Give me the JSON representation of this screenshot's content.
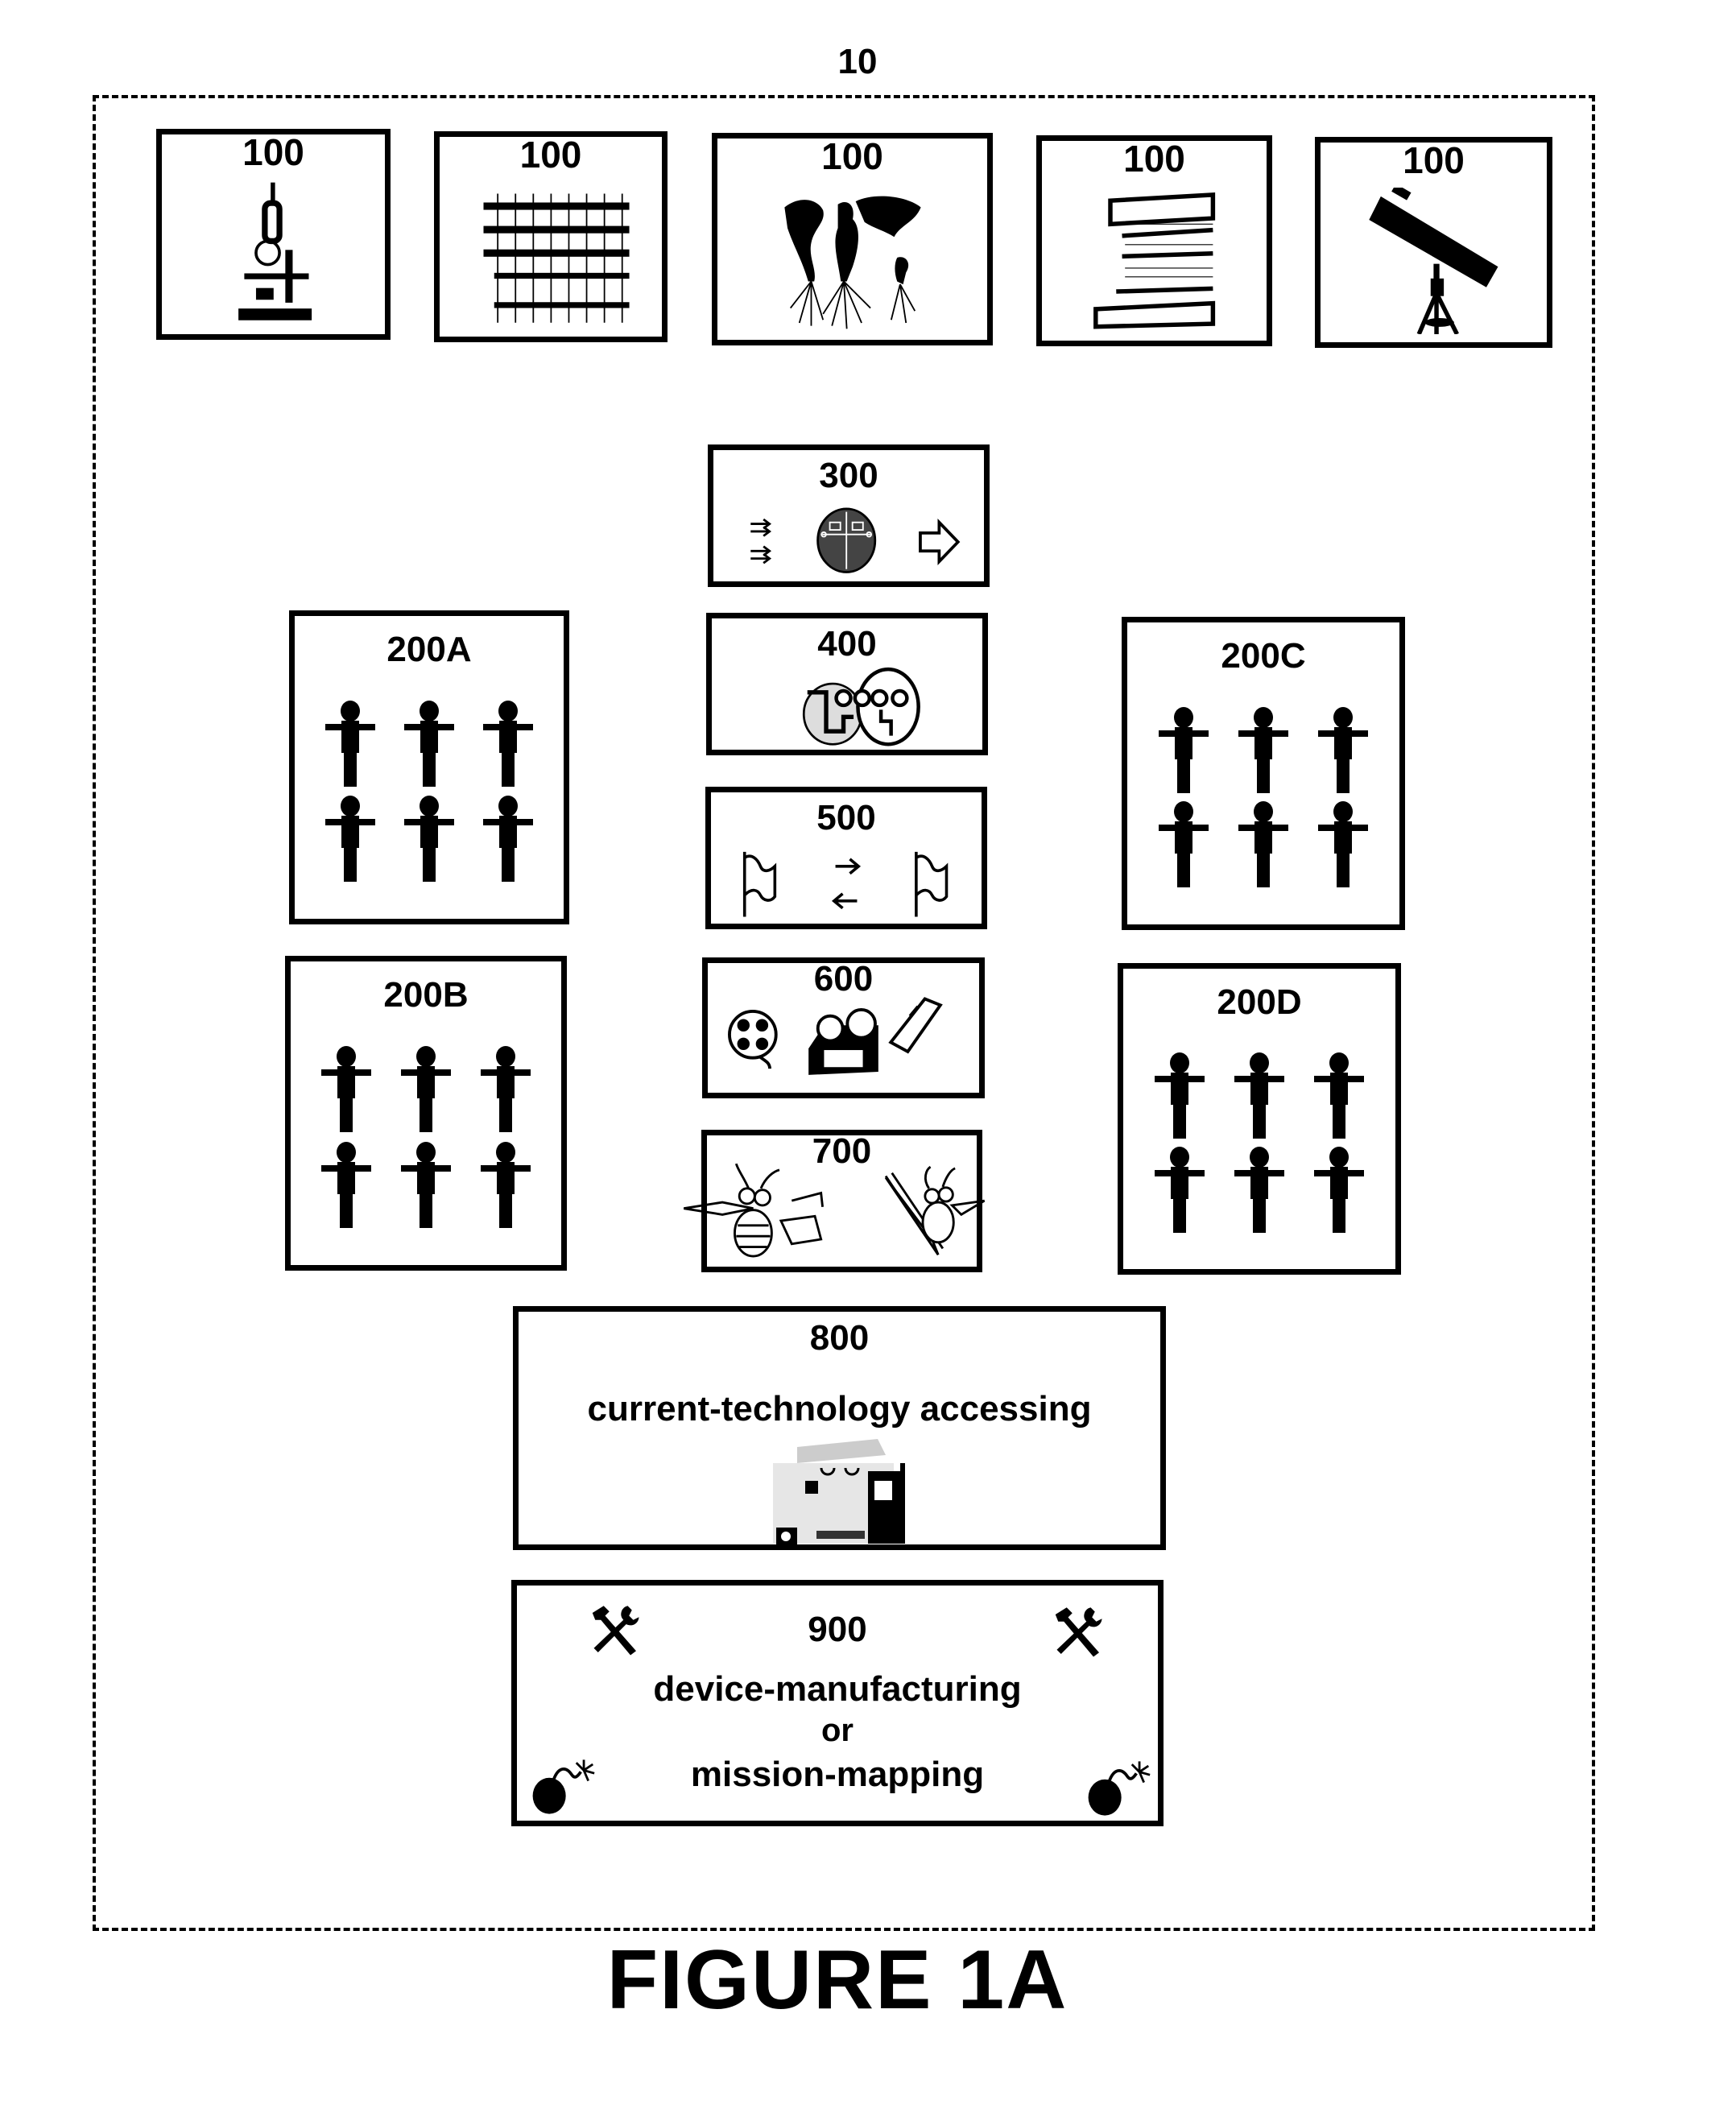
{
  "figure": {
    "system_ref": "10",
    "caption": "FIGURE 1A"
  },
  "top_row": [
    {
      "ref": "100",
      "icon": "microscope-icon"
    },
    {
      "ref": "100",
      "icon": "text-document-icon"
    },
    {
      "ref": "100",
      "icon": "world-map-roots-icon"
    },
    {
      "ref": "100",
      "icon": "books-stack-icon"
    },
    {
      "ref": "100",
      "icon": "telescope-icon"
    }
  ],
  "center_column": [
    {
      "ref": "300",
      "icons": [
        "double-arrows-icon",
        "circuit-globe-icon",
        "right-arrow-icon"
      ]
    },
    {
      "ref": "400",
      "icons": [
        "faces-with-glasses-icon"
      ]
    },
    {
      "ref": "500",
      "icons": [
        "flag-icon",
        "exchange-arrows-icon",
        "flag-icon"
      ]
    },
    {
      "ref": "600",
      "icons": [
        "film-reel-icon",
        "projector-icon",
        "handheld-device-icon"
      ]
    },
    {
      "ref": "700",
      "icons": [
        "bee-with-paper-icon",
        "bee-with-pencil-icon"
      ]
    }
  ],
  "groups": [
    {
      "ref": "200A",
      "people_count": 6
    },
    {
      "ref": "200B",
      "people_count": 6
    },
    {
      "ref": "200C",
      "people_count": 6
    },
    {
      "ref": "200D",
      "people_count": 6
    }
  ],
  "box_800": {
    "ref": "800",
    "label": "current-technology accessing",
    "icon": "technology-collage-icon"
  },
  "box_900": {
    "ref": "900",
    "line1": "device-manufacturing",
    "line2": "or",
    "line3": "mission-mapping",
    "icons": [
      "tools-icon",
      "tools-icon",
      "bomb-icon",
      "bomb-icon"
    ]
  }
}
